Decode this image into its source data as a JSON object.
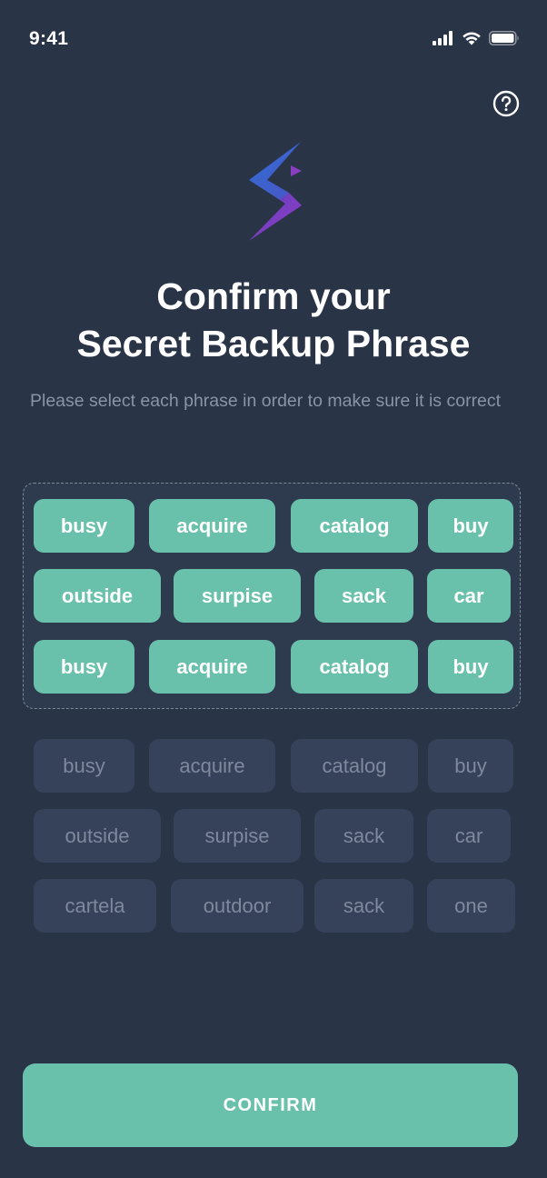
{
  "status_bar": {
    "time": "9:41"
  },
  "header": {
    "help_icon": "question-circle-icon"
  },
  "title_line1": "Confirm your",
  "title_line2": "Secret Backup Phrase",
  "subtitle": "Please select each phrase in order to make sure it is correct",
  "selected_words": [
    {
      "label": "busy"
    },
    {
      "label": "acquire"
    },
    {
      "label": "catalog"
    },
    {
      "label": "buy"
    },
    {
      "label": "outside"
    },
    {
      "label": "surpise"
    },
    {
      "label": "sack"
    },
    {
      "label": "car"
    },
    {
      "label": "busy"
    },
    {
      "label": "acquire"
    },
    {
      "label": "catalog"
    },
    {
      "label": "buy"
    }
  ],
  "available_words": [
    {
      "label": "busy"
    },
    {
      "label": "acquire"
    },
    {
      "label": "catalog"
    },
    {
      "label": "buy"
    },
    {
      "label": "outside"
    },
    {
      "label": "surpise"
    },
    {
      "label": "sack"
    },
    {
      "label": "car"
    },
    {
      "label": "cartela"
    },
    {
      "label": "outdoor"
    },
    {
      "label": "sack"
    },
    {
      "label": "one"
    }
  ],
  "confirm_label": "CONFIRM",
  "colors": {
    "background": "#2a3447",
    "accent": "#6ac1ab",
    "chip_inactive": "#36415a"
  }
}
